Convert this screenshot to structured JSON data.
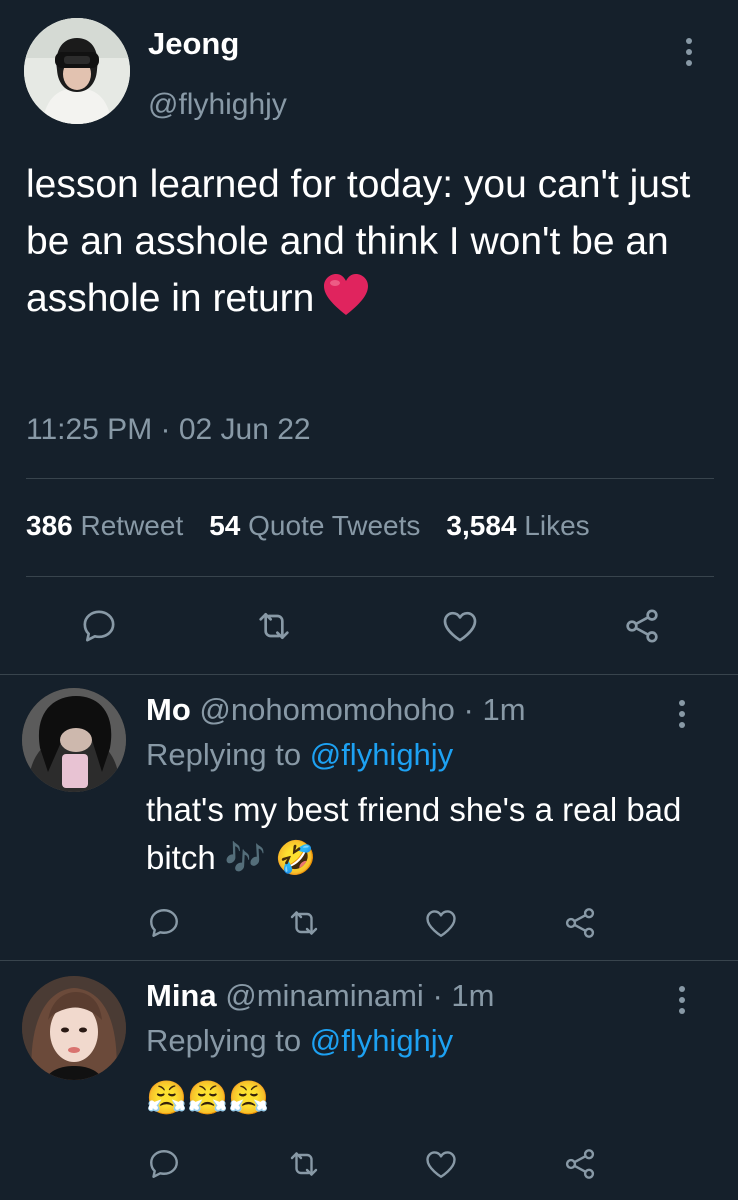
{
  "tweet": {
    "author_name": "Jeong",
    "author_handle": "@flyhighjy",
    "text": "lesson learned for today: you can't just be an asshole and think I won't be an asshole in return",
    "emoji": "red-heart",
    "timestamp": "11:25 PM · 02 Jun 22",
    "stats": {
      "retweets_count": "386",
      "retweets_label": "Retweet",
      "quotes_count": "54",
      "quotes_label": "Quote Tweets",
      "likes_count": "3,584",
      "likes_label": "Likes"
    }
  },
  "replies": [
    {
      "name": "Mo",
      "handle": "@nohomomohoho",
      "time": "1m",
      "replying_prefix": "Replying to",
      "replying_handle": "@flyhighjy",
      "text": "that's my best friend she's a real bad bitch 🎶 🤣"
    },
    {
      "name": "Mina",
      "handle": "@minaminami",
      "time": "1m",
      "replying_prefix": "Replying to",
      "replying_handle": "@flyhighjy",
      "text": "😤😤😤"
    }
  ],
  "colors": {
    "background": "#15202b",
    "secondary_text": "#8899a6",
    "link": "#1da1f2",
    "divider": "#38444d",
    "heart": "#e0245e"
  }
}
